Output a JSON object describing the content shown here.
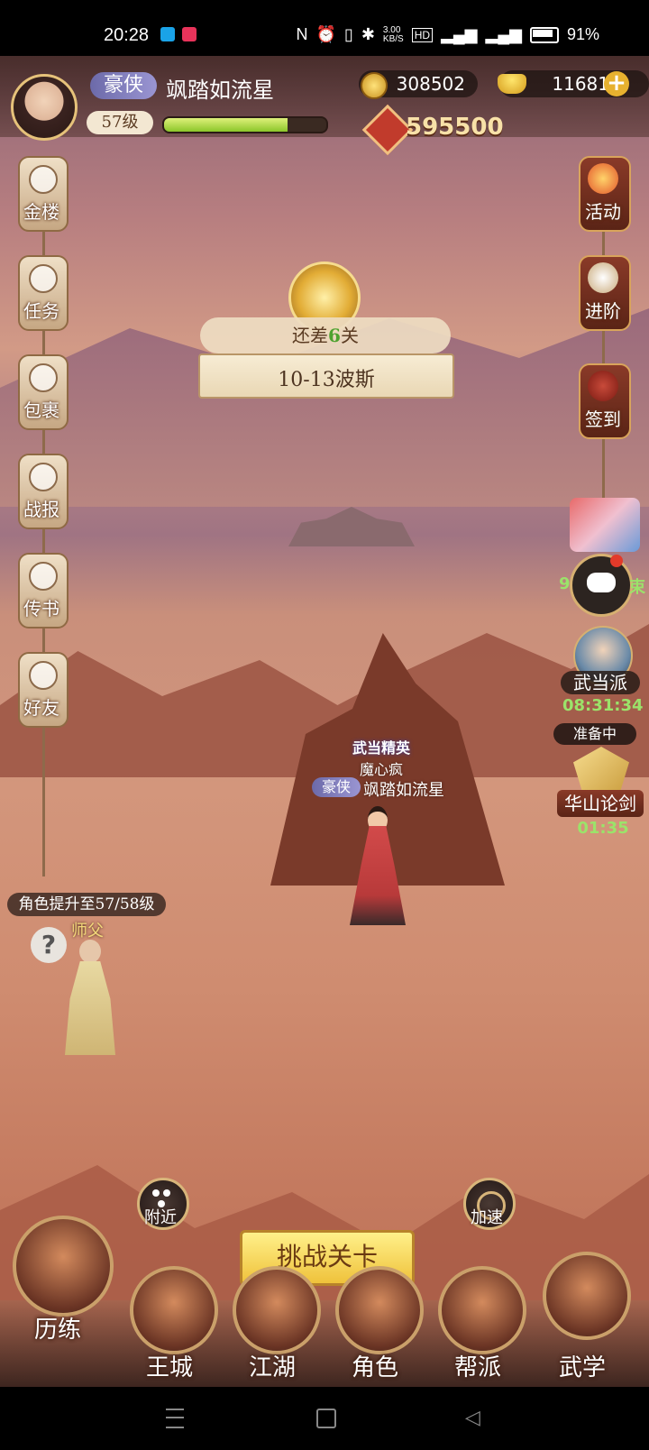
{
  "status_bar": {
    "time": "20:28",
    "net_speed": "3.00\nKB/S",
    "battery": "91%"
  },
  "player": {
    "title": "豪侠",
    "name": "飒踏如流星",
    "level": "57级",
    "exp_fraction": 0.76,
    "coins": "308502",
    "ingots": "11681",
    "power": "595500"
  },
  "left_menu": [
    {
      "label": "金楼",
      "icon": "tower-icon"
    },
    {
      "label": "任务",
      "icon": "flag-icon"
    },
    {
      "label": "包裹",
      "icon": "bag-icon"
    },
    {
      "label": "战报",
      "icon": "battle-report-icon"
    },
    {
      "label": "传书",
      "icon": "pigeon-icon"
    },
    {
      "label": "好友",
      "icon": "friends-icon"
    }
  ],
  "right_menu": [
    {
      "label": "活动",
      "icon": "activity-icon"
    },
    {
      "label": "进阶",
      "icon": "advance-icon"
    },
    {
      "label": "签到",
      "icon": "checkin-icon"
    }
  ],
  "stage": {
    "remain_prefix": "还差",
    "remain_count": "6",
    "remain_suffix": "关",
    "name": "10-13波斯"
  },
  "events": {
    "chat_left": "9",
    "chat_right": "束",
    "wudang_label": "武当派",
    "wudang_timer": "08:31:34",
    "huashan_status": "准备中",
    "huashan_label": "华山论剑",
    "huashan_timer": "01:35"
  },
  "character": {
    "rank_badge": "武当精英",
    "subtitle": "魔心疯",
    "title": "豪侠",
    "name": "飒踏如流星"
  },
  "npc": {
    "requirement": "角色提升至57/58级",
    "name": "师父"
  },
  "actions": {
    "nearby": "附近",
    "challenge": "挑战关卡",
    "speedup": "加速"
  },
  "bottom_nav": [
    {
      "label": "历练"
    },
    {
      "label": "王城"
    },
    {
      "label": "江湖"
    },
    {
      "label": "角色"
    },
    {
      "label": "帮派"
    },
    {
      "label": "武学"
    }
  ],
  "colors": {
    "accent_gold": "#efc23b",
    "exp_green": "#8bc62a",
    "timer_green": "#9be36a"
  }
}
